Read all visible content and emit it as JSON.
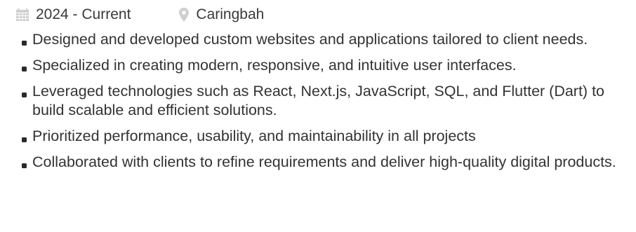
{
  "meta": {
    "date_range": "2024 - Current",
    "location": "Caringbah",
    "date_icon": "calendar-icon",
    "location_icon": "map-pin-icon",
    "icon_color": "#cfcfcf"
  },
  "bullets": [
    "Designed and developed custom websites and applications tailored to client needs.",
    "Specialized in creating modern, responsive, and intuitive user interfaces.",
    "Leveraged technologies such as React, Next.js, JavaScript, SQL, and Flutter (Dart) to build scalable and efficient solutions.",
    "Prioritized performance, usability, and maintainability in all projects",
    "Collaborated with clients to refine requirements and deliver high-quality digital products."
  ]
}
